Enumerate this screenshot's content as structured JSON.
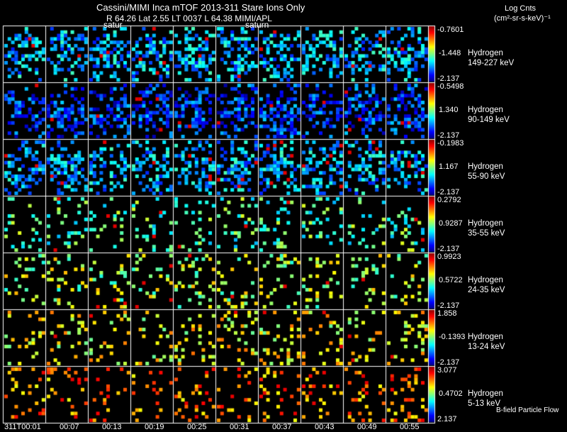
{
  "header": {
    "title": "Cassini/MIMI Inca mTOF  2013-311    Stare    Ions Only",
    "subtitle": "R          64.26 Lat 2.55 LT 0037 L          64.38   MIMI/APL",
    "planet_label_1": "satur",
    "planet_label_2": "saturn"
  },
  "units": {
    "line1": "Log Cnts",
    "line2": "(cm²-sr-s-keV)⁻¹"
  },
  "footer_note": "B-field Particle Flow",
  "chart_data": {
    "type": "heatmap",
    "title": "Cassini/MIMI Inca mTOF  2013-311",
    "x_tick_labels": [
      "311T00:01",
      "00:07",
      "00:13",
      "00:19",
      "00:25",
      "00:31",
      "00:37",
      "00:43",
      "00:49",
      "00:55"
    ],
    "rows": [
      {
        "species": "Hydrogen",
        "energy": "149-227 keV",
        "cb_max": "-0.7601",
        "cb_mid": "-1.448",
        "cb_min": "-2.137",
        "level": 0.3
      },
      {
        "species": "Hydrogen",
        "energy": "90-149 keV",
        "cb_max": "-0.5498",
        "cb_mid": "1.340",
        "cb_min": "-2.137",
        "level": 0.18
      },
      {
        "species": "Hydrogen",
        "energy": "55-90 keV",
        "cb_max": "-0.1983",
        "cb_mid": "1.167",
        "cb_min": "-2.137",
        "level": 0.3
      },
      {
        "species": "Hydrogen",
        "energy": "35-55 keV",
        "cb_max": "0.2792",
        "cb_mid": "0.9287",
        "cb_min": "-2.137",
        "level": 0.45
      },
      {
        "species": "Hydrogen",
        "energy": "24-35 keV",
        "cb_max": "0.9923",
        "cb_mid": "0.5722",
        "cb_min": "-2.137",
        "level": 0.55
      },
      {
        "species": "Hydrogen",
        "energy": "13-24 keV",
        "cb_max": "1.858",
        "cb_mid": "-0.1393",
        "cb_min": "-2.137",
        "level": 0.62
      },
      {
        "species": "Hydrogen",
        "energy": "5-13 keV",
        "cb_max": "3.077",
        "cb_mid": "0.4702",
        "cb_min": "2.137",
        "level": 0.75
      }
    ]
  }
}
